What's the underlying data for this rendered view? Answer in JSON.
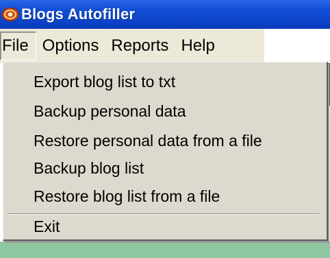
{
  "window": {
    "title": "Blogs Autofiller",
    "icon": "app-logo-icon"
  },
  "menubar": {
    "items": [
      {
        "label": "File",
        "active": true
      },
      {
        "label": "Options",
        "active": false
      },
      {
        "label": "Reports",
        "active": false
      },
      {
        "label": "Help",
        "active": false
      }
    ]
  },
  "file_menu": {
    "items": [
      {
        "label": "Export blog list to txt"
      },
      {
        "label": "Backup personal data"
      },
      {
        "label": "Restore personal data from a file"
      },
      {
        "label": "Backup blog list"
      },
      {
        "label": "Restore blog list from a file"
      }
    ],
    "exit_label": "Exit"
  },
  "colors": {
    "titlebar": "#0c45cc",
    "menu_bg": "#ddd9cf",
    "app_green": "#8fc7a0"
  }
}
